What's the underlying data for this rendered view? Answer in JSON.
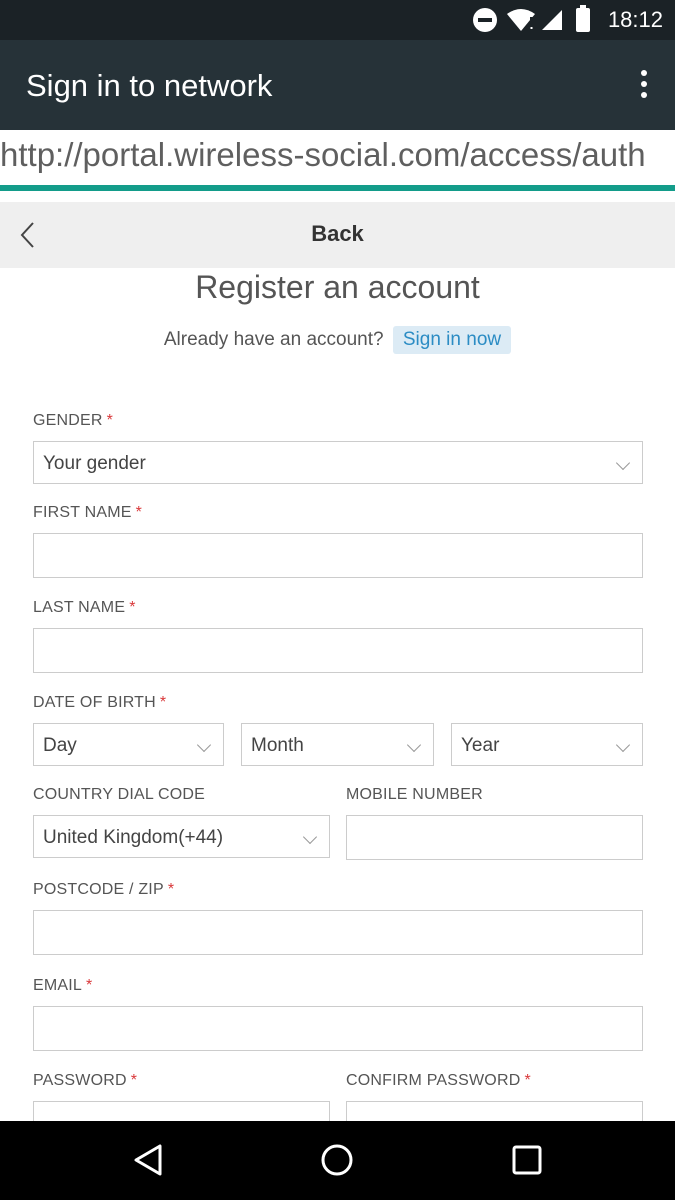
{
  "status_bar": {
    "time": "18:12"
  },
  "app_bar": {
    "title": "Sign in to network"
  },
  "url_bar": {
    "url": "http://portal.wireless-social.com/access/auth"
  },
  "back_bar": {
    "label": "Back"
  },
  "form": {
    "heading": "Register an account",
    "already_text": "Already have an account?",
    "signin_link": "Sign in now",
    "required_mark": "*",
    "gender": {
      "label": "GENDER",
      "value": "Your gender"
    },
    "first_name": {
      "label": "FIRST NAME",
      "value": ""
    },
    "last_name": {
      "label": "LAST NAME",
      "value": ""
    },
    "dob": {
      "label": "DATE OF BIRTH",
      "day": "Day",
      "month": "Month",
      "year": "Year"
    },
    "dial_code": {
      "label": "COUNTRY DIAL CODE",
      "value": "United Kingdom(+44)"
    },
    "mobile": {
      "label": "MOBILE NUMBER",
      "value": ""
    },
    "postcode": {
      "label": "POSTCODE / ZIP",
      "value": ""
    },
    "email": {
      "label": "EMAIL",
      "value": ""
    },
    "password": {
      "label": "PASSWORD",
      "value": ""
    },
    "confirm_password": {
      "label": "CONFIRM PASSWORD",
      "value": ""
    }
  },
  "icons": {
    "status": [
      "do-not-disturb-icon",
      "wifi-icon",
      "signal-icon",
      "battery-icon"
    ],
    "app_bar": [
      "overflow-menu-icon"
    ],
    "nav": [
      "nav-back-icon",
      "nav-home-icon",
      "nav-recents-icon"
    ]
  },
  "colors": {
    "status_bar": "#1b2226",
    "app_bar": "#263238",
    "progress": "#139c8a",
    "link_bg": "#dcebf5",
    "link_text": "#2b8cc4",
    "required": "#d9383a"
  }
}
